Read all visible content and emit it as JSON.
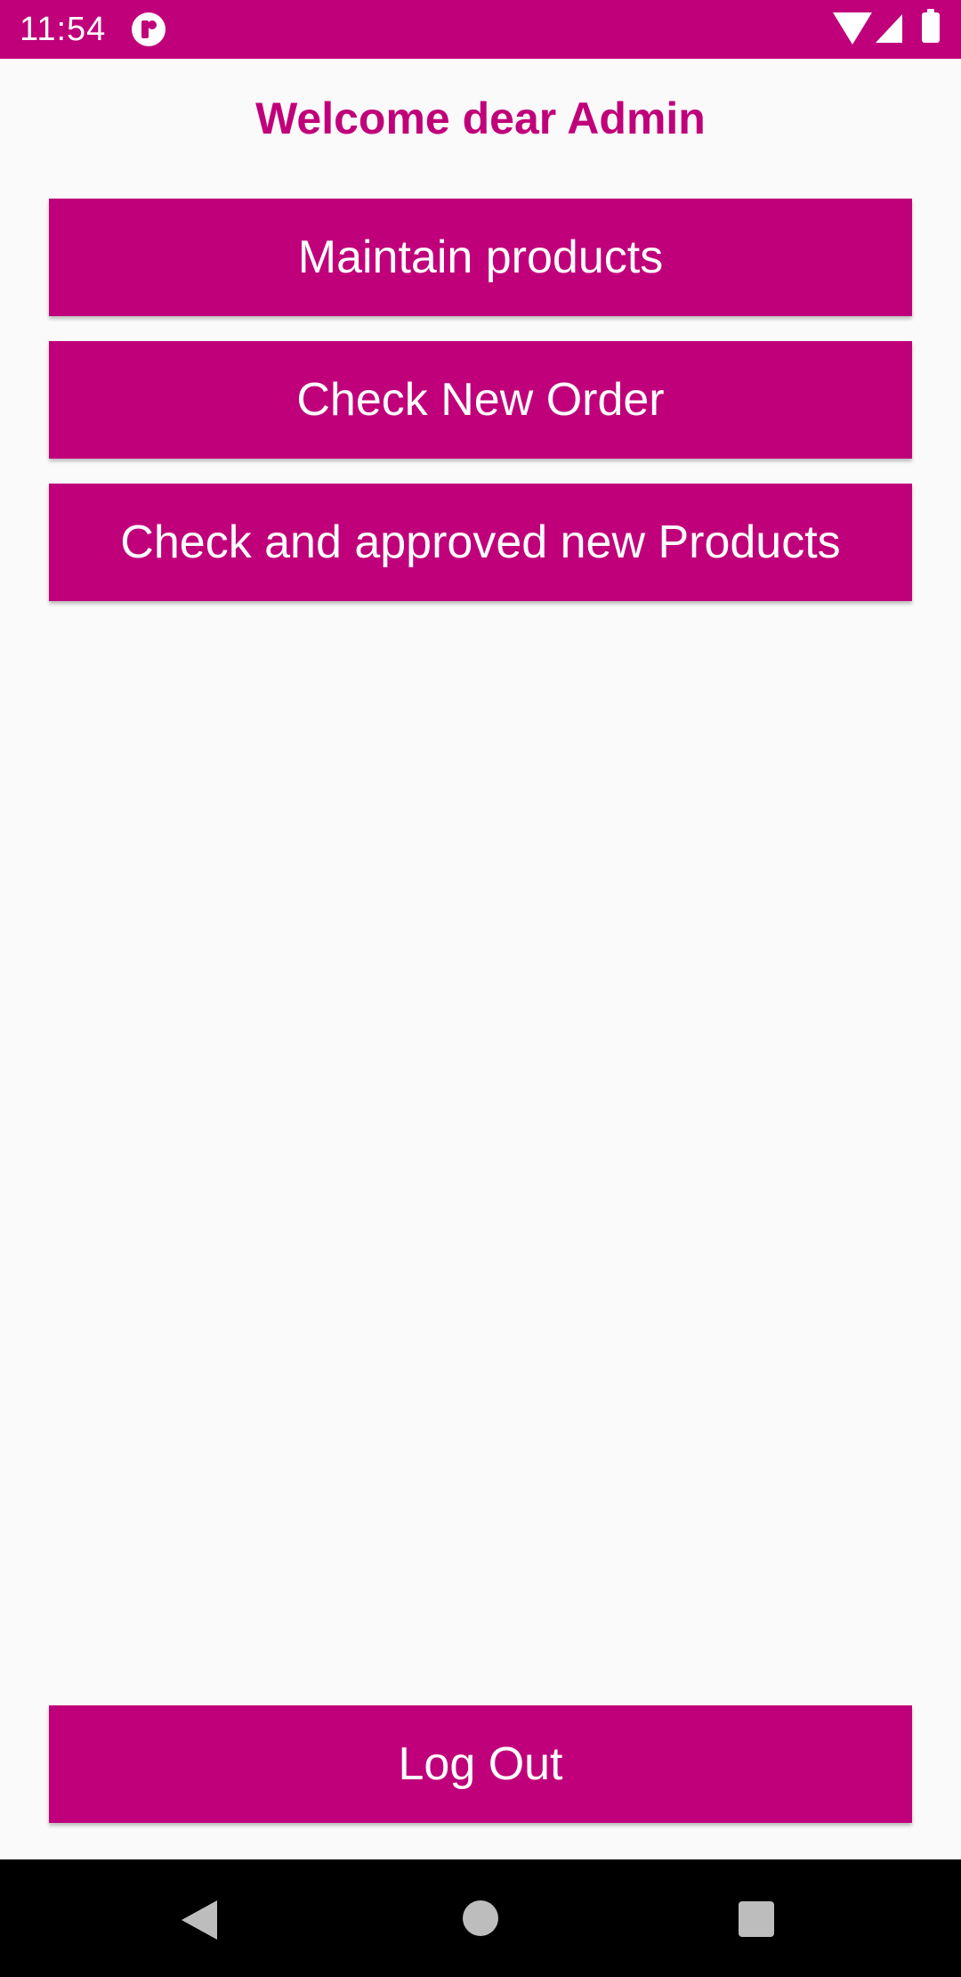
{
  "status_bar": {
    "time": "11:54",
    "icons": [
      "app-notification-icon",
      "wifi-icon",
      "signal-icon",
      "battery-icon"
    ]
  },
  "header": {
    "title": "Welcome dear Admin"
  },
  "menu": {
    "buttons": [
      {
        "label": "Maintain products"
      },
      {
        "label": "Check New Order"
      },
      {
        "label": "Check and approved new Products"
      }
    ]
  },
  "footer": {
    "logout_label": "Log Out"
  },
  "nav_bar": {
    "icons": [
      "back-icon",
      "home-icon",
      "recents-icon"
    ]
  },
  "colors": {
    "accent": "#C0007A",
    "background": "#FAFAFA",
    "nav_bar": "#000000"
  }
}
